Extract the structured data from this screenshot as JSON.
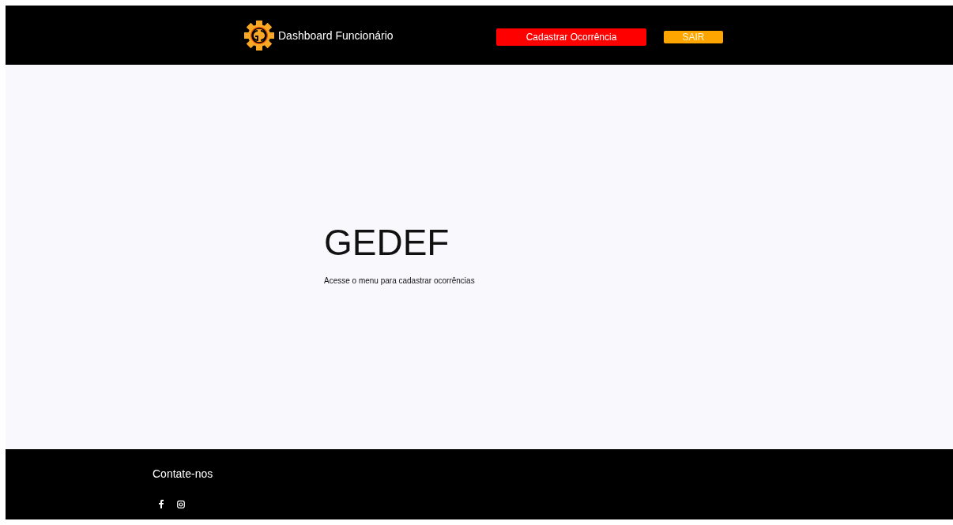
{
  "header": {
    "title": "Dashboard Funcionário",
    "buttons": [
      {
        "label": "Cadastrar Ocorrência",
        "kind": "primary"
      },
      {
        "label": "SAIR",
        "kind": "exit"
      }
    ]
  },
  "main": {
    "heading": "GEDEF",
    "text": "Acesse o menu para cadastrar ocorrências"
  },
  "footer": {
    "title": "Contate-nos",
    "socials": [
      {
        "kind": "facebook"
      },
      {
        "kind": "instagram"
      }
    ]
  }
}
